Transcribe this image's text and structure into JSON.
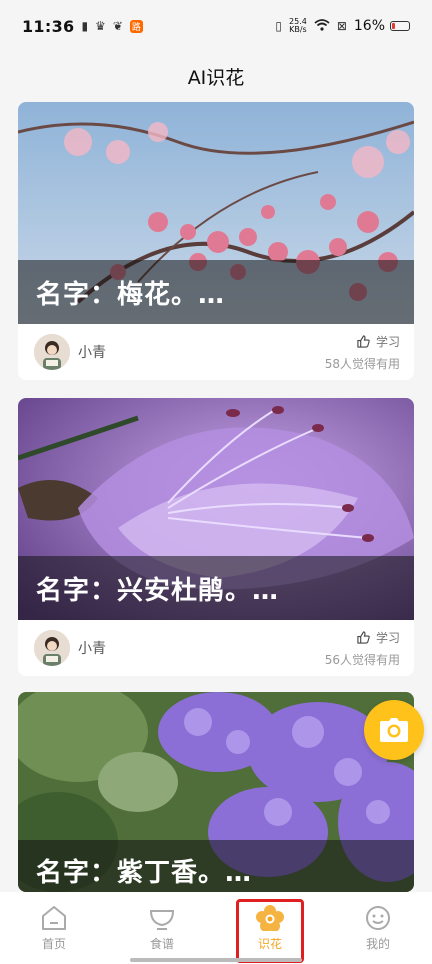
{
  "status_bar": {
    "time": "11:36",
    "app_badge": "路",
    "net_speed_top": "25.4",
    "net_speed_unit": "KB/s",
    "battery": "16%"
  },
  "header": {
    "title": "AI识花"
  },
  "cards": [
    {
      "title": "名字：梅花。…",
      "author": "小青",
      "like_label": "学习",
      "useful_text": "58人觉得有用"
    },
    {
      "title": "名字：兴安杜鹃。…",
      "author": "小青",
      "like_label": "学习",
      "useful_text": "56人觉得有用"
    },
    {
      "title": "名字：紫丁香。…"
    }
  ],
  "tabs": [
    {
      "label": "首页",
      "icon": "home-icon"
    },
    {
      "label": "食谱",
      "icon": "bowl-icon"
    },
    {
      "label": "识花",
      "icon": "flower-icon",
      "active": true
    },
    {
      "label": "我的",
      "icon": "smile-icon"
    }
  ],
  "colors": {
    "accent": "#f5a623",
    "fab": "#ffc21a",
    "highlight": "#e02020"
  }
}
